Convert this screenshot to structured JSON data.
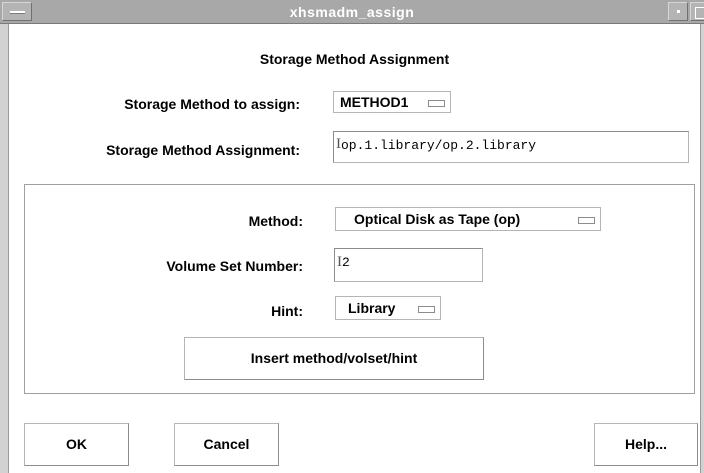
{
  "window": {
    "title": "xhsmadm_assign"
  },
  "dialog": {
    "heading": "Storage Method Assignment",
    "method_to_assign": {
      "label": "Storage Method to assign:",
      "value": "METHOD1"
    },
    "assignment": {
      "label": "Storage Method Assignment:",
      "value": "op.1.library/op.2.library"
    }
  },
  "panel": {
    "method": {
      "label": "Method:",
      "value": "Optical Disk as Tape (op)"
    },
    "volume_set": {
      "label": "Volume Set Number:",
      "value": "2"
    },
    "hint": {
      "label": "Hint:",
      "value": "Library"
    },
    "insert_button": "Insert method/volset/hint"
  },
  "buttons": {
    "ok": "OK",
    "cancel": "Cancel",
    "help": "Help..."
  },
  "icons": {
    "window_menu": "window-menu-icon",
    "minimize": "minimize-icon",
    "maximize": "maximize-icon",
    "option_indicator": "option-menu-indicator-icon",
    "text_cursor": "text-cursor-icon"
  }
}
